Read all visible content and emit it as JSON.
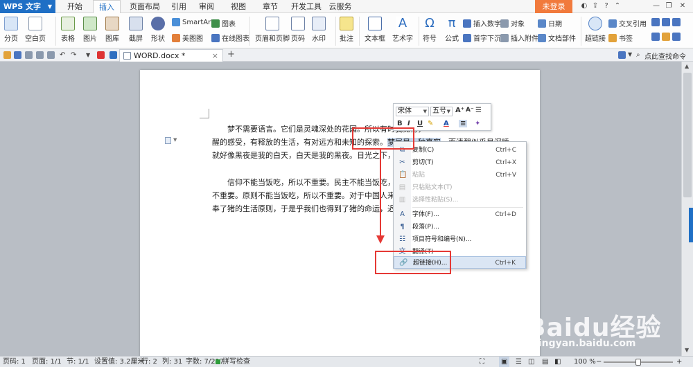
{
  "app": {
    "name": "WPS 文字"
  },
  "menu": {
    "tabs": [
      "开始",
      "插入",
      "页面布局",
      "引用",
      "审阅",
      "视图",
      "章节",
      "开发工具",
      "云服务"
    ],
    "active": "插入",
    "login": "未登录"
  },
  "ribbon": {
    "page_split": "分页",
    "blank_page": "空白页",
    "table": "表格",
    "picture": "图片",
    "gallery": "图库",
    "screenshot": "截屏",
    "shape": "形状",
    "smartart": "SmartArt",
    "chart": "图表",
    "beauty_chart": "美图图",
    "online_chart": "在线图表",
    "header_footer": "页眉和页脚",
    "page_number": "页码",
    "watermark": "水印",
    "comment": "批注",
    "textbox": "文本框",
    "wordart": "艺术字",
    "symbol": "符号",
    "formula": "公式",
    "insert_number": "插入数字",
    "drop_cap": "首字下沉",
    "object": "对象",
    "attachment": "插入附件",
    "date": "日期",
    "doc_part": "文档部件",
    "hyperlink": "超链接",
    "cross_ref": "交叉引用",
    "bookmark": "书签"
  },
  "tabbar": {
    "doc_name": "WORD.docx *",
    "help_search": "点此查找命令"
  },
  "document": {
    "para1_line1": "梦不需要语言。它们是灵魂深处的花园。所以有时我觉得，",
    "para1_line2_a": "醒的感受，有释放的生活，有对远方和未知的探索。",
    "para1_line2_hl": "梦属是一种真实",
    "para1_line2_b": "，而清醒似乎是深睡",
    "para1_line3": "就好像黑夜是我的白天，白天是我的黑夜。日光之下，并无新事",
    "para2_line1": "信仰不能当饭吃，所以不重要。民主不能当饭吃，所以不重",
    "para2_line2": "不重要。原则不能当饭吃，所以不重要。对于中国人来讲，不能",
    "para2_line3": "奉了猪的生活原则，于是乎我们也得到了猪的命运，迟早要别人"
  },
  "mini_toolbar": {
    "font": "宋体",
    "size": "五号"
  },
  "context_menu": [
    {
      "label": "复制(C)",
      "shortcut": "Ctrl+C",
      "icon": "copy-icon",
      "disabled": false
    },
    {
      "label": "剪切(T)",
      "shortcut": "Ctrl+X",
      "icon": "scissors-icon",
      "disabled": false
    },
    {
      "label": "粘贴",
      "shortcut": "Ctrl+V",
      "icon": "paste-icon",
      "disabled": true
    },
    {
      "label": "只粘贴文本(T)",
      "shortcut": "",
      "icon": "paste-text-icon",
      "disabled": true
    },
    {
      "label": "选择性粘贴(S)...",
      "shortcut": "",
      "icon": "paste-special-icon",
      "disabled": true
    },
    {
      "label": "字体(F)...",
      "shortcut": "Ctrl+D",
      "icon": "font-icon",
      "disabled": false
    },
    {
      "label": "段落(P)...",
      "shortcut": "",
      "icon": "paragraph-icon",
      "disabled": false
    },
    {
      "label": "项目符号和编号(N)...",
      "shortcut": "",
      "icon": "list-icon",
      "disabled": false
    },
    {
      "label": "翻译(T)",
      "shortcut": "",
      "icon": "translate-icon",
      "disabled": false
    },
    {
      "label": "超链接(H)...",
      "shortcut": "Ctrl+K",
      "icon": "hyperlink-icon",
      "disabled": false,
      "hover": true
    }
  ],
  "status": {
    "page_num": "页码: 1",
    "pages": "页面: 1/1",
    "section": "节: 1/1",
    "setting": "设置值: 3.2厘米",
    "row": "行: 2",
    "col": "列: 31",
    "words": "字数: 7/217",
    "spell": "拼写检查",
    "zoom": "100 %"
  },
  "watermark": {
    "brand": "Baidu经验",
    "url": "jingyan.baidu.com"
  }
}
